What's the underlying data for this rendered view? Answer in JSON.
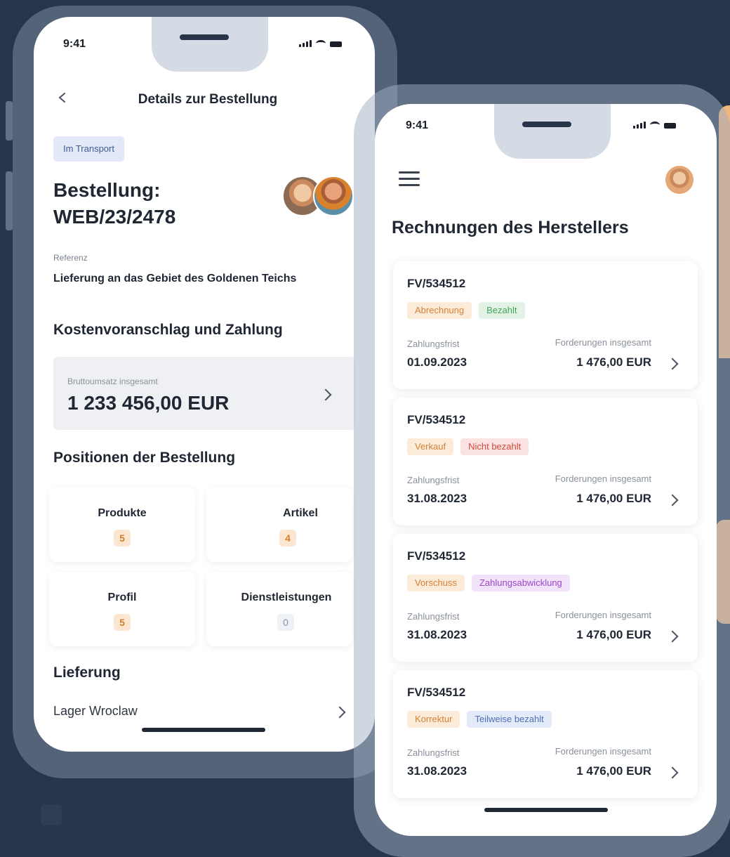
{
  "colors": {
    "background": "#273449",
    "accent": "#f0b57a"
  },
  "phone_left": {
    "time": "9:41",
    "header": {
      "title": "Details zur Bestellung",
      "back_icon": "chevron-left-icon"
    },
    "status_badge": "Im Transport",
    "order": {
      "title_line1": "Bestellung:",
      "title_line2": "WEB/23/2478"
    },
    "reference": {
      "label": "Referenz",
      "value": "Lieferung an das Gebiet des Goldenen Teichs"
    },
    "quote_section": {
      "heading": "Kostenvoranschlag und Zahlung",
      "gross_label": "Bruttoumsatz insgesamt",
      "gross_value": "1 233 456,00 EUR"
    },
    "positions": {
      "heading": "Positionen der Bestellung",
      "tiles": [
        {
          "label": "Produkte",
          "count": "5"
        },
        {
          "label": "Artikel",
          "count": "4"
        },
        {
          "label": "Profil",
          "count": "5"
        },
        {
          "label": "Dienstleistungen",
          "count": "0"
        }
      ]
    },
    "delivery": {
      "heading": "Lieferung",
      "value": "Lager Wroclaw"
    }
  },
  "phone_right": {
    "time": "9:41",
    "title": "Rechnungen des Herstellers",
    "invoices": [
      {
        "number": "FV/534512",
        "tag1": "Abrechnung",
        "tag2": "Bezahlt",
        "due_label": "Zahlungsfrist",
        "due_date": "01.09.2023",
        "claims_label": "Forderungen insgesamt",
        "claims_value": "1 476,00 EUR"
      },
      {
        "number": "FV/534512",
        "tag1": "Verkauf",
        "tag2": "Nicht bezahlt",
        "due_label": "Zahlungsfrist",
        "due_date": "31.08.2023",
        "claims_label": "Forderungen insgesamt",
        "claims_value": "1 476,00 EUR"
      },
      {
        "number": "FV/534512",
        "tag1": "Vorschuss",
        "tag2": "Zahlungsabwicklung",
        "due_label": "Zahlungsfrist",
        "due_date": "31.08.2023",
        "claims_label": "Forderungen insgesamt",
        "claims_value": "1 476,00 EUR"
      },
      {
        "number": "FV/534512",
        "tag1": "Korrektur",
        "tag2": "Teilweise bezahlt",
        "due_label": "Zahlungsfrist",
        "due_date": "31.08.2023",
        "claims_label": "Forderungen insgesamt",
        "claims_value": "1 476,00 EUR"
      }
    ]
  }
}
